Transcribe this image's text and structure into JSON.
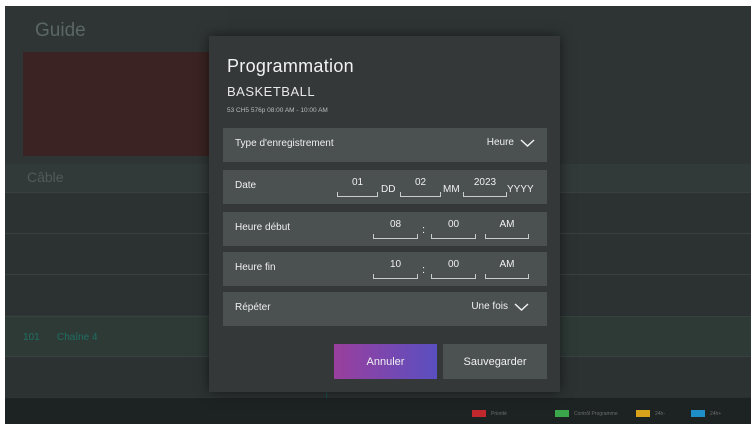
{
  "guide": {
    "title": "Guide",
    "category": "Câble",
    "channel_number": "101",
    "channel_name": "Chaîne 4",
    "legend": [
      {
        "label": "Priorité",
        "color": "#c0282d"
      },
      {
        "label": "Contrôl Programme",
        "color": "#3aa84a"
      },
      {
        "label": "24h-",
        "color": "#d9a21b"
      },
      {
        "label": "24h+",
        "color": "#1e8ec9"
      }
    ]
  },
  "dialog": {
    "title": "Programmation",
    "program": "BASKETBALL",
    "info": "53 CH5 576p  08:00 AM - 10:00 AM",
    "record_type": {
      "label": "Type d'enregistrement",
      "value": "Heure"
    },
    "date": {
      "label": "Date",
      "day": "01",
      "day_unit": "DD",
      "month": "02",
      "month_unit": "MM",
      "year": "2023",
      "year_unit": "YYYY"
    },
    "start": {
      "label": "Heure début",
      "hour": "08",
      "minute": "00",
      "ampm": "AM"
    },
    "end": {
      "label": "Heure fin",
      "hour": "10",
      "minute": "00",
      "ampm": "AM"
    },
    "repeat": {
      "label": "Répéter",
      "value": "Une fois"
    },
    "buttons": {
      "cancel": "Annuler",
      "save": "Sauvegarder"
    }
  }
}
